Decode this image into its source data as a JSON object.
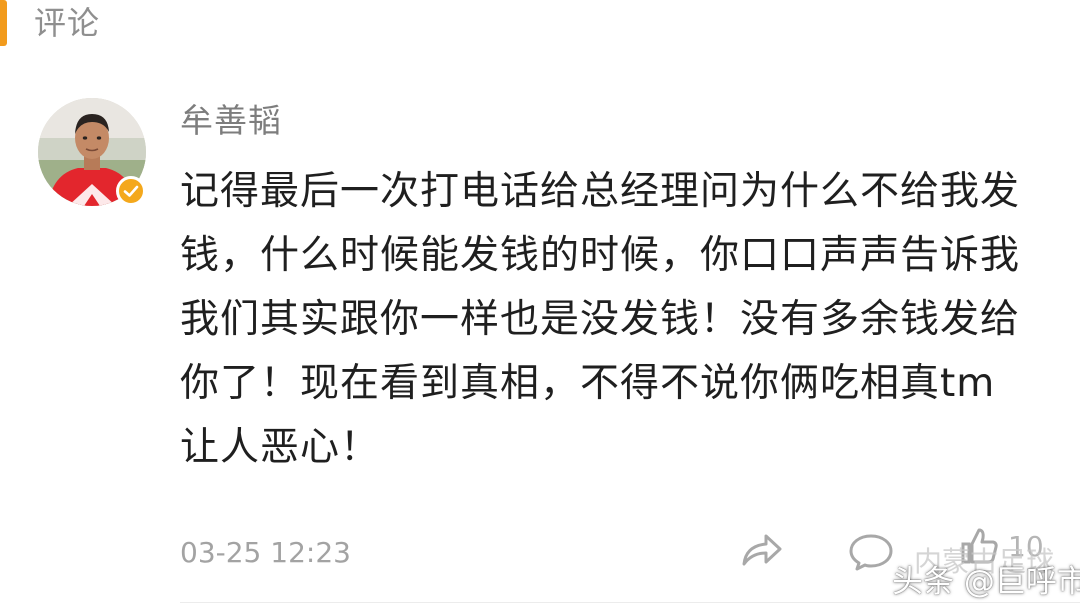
{
  "header": {
    "title": "评论",
    "accent_color": "#f29b1d"
  },
  "comment": {
    "avatar": {
      "icon": "user-avatar-photo",
      "verified_badge_icon": "verified-check-icon",
      "verified_color": "#f4a81c"
    },
    "username": "牟善韬",
    "text": "记得最后一次打电话给总经理问为什么不给我发钱，什么时候能发钱的时候，你口口声声告诉我我们其实跟你一样也是没发钱！没有多余钱发给你了！现在看到真相，不得不说你俩吃相真tm让人恶心！",
    "timestamp": "03-25 12:23",
    "actions": {
      "share_icon": "share-arrow-icon",
      "comment_icon": "comment-bubble-icon",
      "like_icon": "thumbs-up-icon",
      "like_count": "10"
    }
  },
  "watermark": {
    "faded": "内蒙古足球",
    "main": "头条 @巨呼市"
  }
}
